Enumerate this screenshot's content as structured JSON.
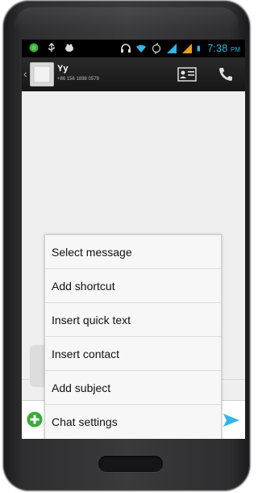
{
  "status_bar": {
    "time": "7:38",
    "ampm": "PM",
    "icons": [
      "android-icon",
      "usb-icon",
      "alert-icon",
      "headset-icon",
      "wifi-icon",
      "sync-icon",
      "signal-icon",
      "signal-icon",
      "battery-icon"
    ]
  },
  "header": {
    "contact_name": "Yy",
    "contact_number": "+86 156 1898 0579",
    "colors": {
      "accent": "#33b5e5",
      "bar": "#1e1e1e"
    }
  },
  "menu": {
    "items": [
      {
        "label": "Select message"
      },
      {
        "label": "Add shortcut"
      },
      {
        "label": "Insert quick text"
      },
      {
        "label": "Insert contact"
      },
      {
        "label": "Add subject"
      },
      {
        "label": "Chat settings"
      }
    ]
  },
  "compose": {
    "add_color": "#3aa83a",
    "send_color": "#33b5e5"
  }
}
